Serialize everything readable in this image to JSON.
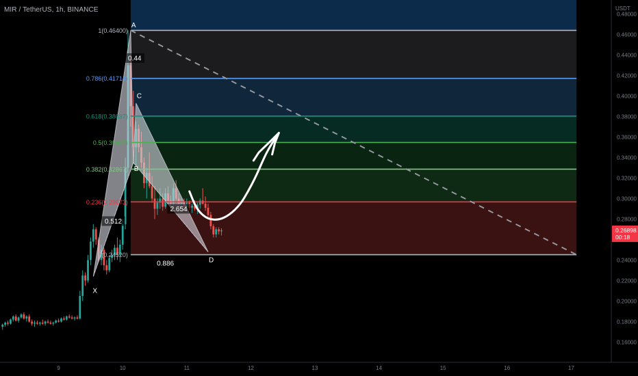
{
  "header": {
    "symbol_line": "MIR / TetherUS, 1h, BINANCE"
  },
  "price_axis": {
    "unit": "USDT"
  },
  "colors": {
    "background": "#000000",
    "candle_up": "#26a69a",
    "candle_down": "#ef5350",
    "level_1": "#b2b5be",
    "level_0786": "#5b9cf6",
    "level_0618": "#089981",
    "level_05": "#4caf50",
    "level_0382": "#81c784",
    "level_0236": "#f23645",
    "level_0": "#b2b5be",
    "pattern_fill": "#d1d4dc",
    "last_price_tag": "#f23645"
  },
  "chart_data": {
    "type": "candlestick",
    "y_axis": {
      "min": 0.14,
      "max": 0.49,
      "ticks": [
        "0.48000",
        "0.46000",
        "0.44000",
        "0.42000",
        "0.40000",
        "0.38000",
        "0.36000",
        "0.34000",
        "0.32000",
        "0.30000",
        "0.28000",
        "0.26000",
        "0.24000",
        "0.22000",
        "0.20000",
        "0.18000",
        "0.16000"
      ]
    },
    "x_axis": {
      "ticks": [
        "9",
        "10",
        "11",
        "12",
        "13",
        "14",
        "15",
        "16",
        "17"
      ],
      "tick_hours": [
        0,
        24,
        48,
        72,
        96,
        120,
        144,
        168,
        192
      ]
    },
    "candles": [
      [
        -21,
        0.175,
        0.178,
        0.172,
        0.177
      ],
      [
        -20,
        0.177,
        0.18,
        0.175,
        0.179
      ],
      [
        -19,
        0.179,
        0.181,
        0.176,
        0.178
      ],
      [
        -18,
        0.178,
        0.183,
        0.177,
        0.182
      ],
      [
        -17,
        0.182,
        0.186,
        0.18,
        0.185
      ],
      [
        -16,
        0.185,
        0.187,
        0.18,
        0.181
      ],
      [
        -15,
        0.181,
        0.185,
        0.179,
        0.184
      ],
      [
        -14,
        0.184,
        0.188,
        0.183,
        0.187
      ],
      [
        -13,
        0.187,
        0.189,
        0.182,
        0.183
      ],
      [
        -12,
        0.183,
        0.186,
        0.18,
        0.185
      ],
      [
        -11,
        0.185,
        0.187,
        0.179,
        0.18
      ],
      [
        -10,
        0.18,
        0.182,
        0.176,
        0.178
      ],
      [
        -9,
        0.178,
        0.181,
        0.175,
        0.179
      ],
      [
        -8,
        0.179,
        0.181,
        0.177,
        0.178
      ],
      [
        -7,
        0.178,
        0.18,
        0.176,
        0.179
      ],
      [
        -6,
        0.179,
        0.182,
        0.177,
        0.178
      ],
      [
        -5,
        0.178,
        0.181,
        0.176,
        0.18
      ],
      [
        -4,
        0.18,
        0.182,
        0.178,
        0.179
      ],
      [
        -3,
        0.179,
        0.181,
        0.177,
        0.178
      ],
      [
        -2,
        0.178,
        0.18,
        0.176,
        0.179
      ],
      [
        -1,
        0.179,
        0.182,
        0.178,
        0.181
      ],
      [
        0,
        0.181,
        0.183,
        0.179,
        0.18
      ],
      [
        1,
        0.18,
        0.184,
        0.179,
        0.183
      ],
      [
        2,
        0.183,
        0.185,
        0.181,
        0.182
      ],
      [
        3,
        0.182,
        0.186,
        0.181,
        0.185
      ],
      [
        4,
        0.185,
        0.187,
        0.183,
        0.184
      ],
      [
        5,
        0.184,
        0.186,
        0.182,
        0.183
      ],
      [
        6,
        0.183,
        0.185,
        0.181,
        0.184
      ],
      [
        7,
        0.184,
        0.186,
        0.182,
        0.183
      ],
      [
        8,
        0.183,
        0.21,
        0.182,
        0.205
      ],
      [
        9,
        0.205,
        0.23,
        0.2,
        0.225
      ],
      [
        10,
        0.225,
        0.228,
        0.215,
        0.22
      ],
      [
        11,
        0.22,
        0.245,
        0.218,
        0.24
      ],
      [
        12,
        0.24,
        0.262,
        0.235,
        0.258
      ],
      [
        13,
        0.258,
        0.275,
        0.252,
        0.27
      ],
      [
        14,
        0.27,
        0.272,
        0.255,
        0.26
      ],
      [
        15,
        0.26,
        0.262,
        0.238,
        0.24
      ],
      [
        16,
        0.24,
        0.255,
        0.235,
        0.25
      ],
      [
        17,
        0.25,
        0.252,
        0.23,
        0.235
      ],
      [
        18,
        0.235,
        0.24,
        0.226,
        0.23
      ],
      [
        19,
        0.23,
        0.245,
        0.228,
        0.242
      ],
      [
        20,
        0.242,
        0.25,
        0.238,
        0.245
      ],
      [
        21,
        0.245,
        0.255,
        0.24,
        0.252
      ],
      [
        22,
        0.252,
        0.262,
        0.24,
        0.245
      ],
      [
        23,
        0.245,
        0.26,
        0.238,
        0.255
      ],
      [
        24,
        0.255,
        0.28,
        0.25,
        0.275
      ],
      [
        25,
        0.275,
        0.34,
        0.27,
        0.33
      ],
      [
        26,
        0.33,
        0.464,
        0.32,
        0.43
      ],
      [
        27,
        0.43,
        0.44,
        0.37,
        0.39
      ],
      [
        28,
        0.39,
        0.405,
        0.34,
        0.35
      ],
      [
        29,
        0.35,
        0.375,
        0.332,
        0.368
      ],
      [
        30,
        0.368,
        0.372,
        0.345,
        0.35
      ],
      [
        31,
        0.35,
        0.365,
        0.33,
        0.335
      ],
      [
        32,
        0.335,
        0.34,
        0.31,
        0.315
      ],
      [
        33,
        0.315,
        0.33,
        0.3,
        0.325
      ],
      [
        34,
        0.325,
        0.345,
        0.31,
        0.312
      ],
      [
        35,
        0.312,
        0.322,
        0.296,
        0.3
      ],
      [
        36,
        0.3,
        0.312,
        0.28,
        0.29
      ],
      [
        37,
        0.29,
        0.3,
        0.284,
        0.296
      ],
      [
        38,
        0.296,
        0.31,
        0.29,
        0.3
      ],
      [
        39,
        0.3,
        0.305,
        0.288,
        0.292
      ],
      [
        40,
        0.292,
        0.31,
        0.29,
        0.305
      ],
      [
        41,
        0.305,
        0.312,
        0.295,
        0.298
      ],
      [
        42,
        0.298,
        0.303,
        0.288,
        0.295
      ],
      [
        43,
        0.295,
        0.315,
        0.29,
        0.31
      ],
      [
        44,
        0.31,
        0.318,
        0.298,
        0.3
      ],
      [
        45,
        0.3,
        0.305,
        0.29,
        0.295
      ],
      [
        46,
        0.295,
        0.3,
        0.288,
        0.297
      ],
      [
        47,
        0.297,
        0.3,
        0.29,
        0.292
      ],
      [
        48,
        0.292,
        0.3,
        0.288,
        0.296
      ],
      [
        49,
        0.296,
        0.298,
        0.289,
        0.291
      ],
      [
        50,
        0.291,
        0.295,
        0.286,
        0.293
      ],
      [
        51,
        0.293,
        0.298,
        0.288,
        0.29
      ],
      [
        52,
        0.29,
        0.296,
        0.285,
        0.294
      ],
      [
        53,
        0.294,
        0.3,
        0.29,
        0.298
      ],
      [
        54,
        0.298,
        0.31,
        0.294,
        0.295
      ],
      [
        55,
        0.295,
        0.302,
        0.288,
        0.291
      ],
      [
        56,
        0.291,
        0.295,
        0.282,
        0.284
      ],
      [
        57,
        0.284,
        0.287,
        0.27,
        0.273
      ],
      [
        58,
        0.273,
        0.275,
        0.262,
        0.265
      ],
      [
        59,
        0.265,
        0.272,
        0.262,
        0.27
      ],
      [
        60,
        0.27,
        0.272,
        0.265,
        0.268
      ],
      [
        61,
        0.268,
        0.271,
        0.264,
        0.269
      ]
    ],
    "fib_levels": [
      {
        "ratio": "1",
        "price": 0.464,
        "label": "1(0.46400)",
        "color": "#b2b5be"
      },
      {
        "ratio": "0.786",
        "price": 0.41714,
        "label": "0.786(0.41714)",
        "color": "#5b9cf6"
      },
      {
        "ratio": "0.618",
        "price": 0.38037,
        "label": "0.618(0.38037)",
        "color": "#089981"
      },
      {
        "ratio": "0.5",
        "price": 0.35462,
        "label": "0.5(0.35462)",
        "color": "#4caf50"
      },
      {
        "ratio": "0.382",
        "price": 0.32867,
        "label": "0.382(0.32867)",
        "color": "#81c784"
      },
      {
        "ratio": "0.236",
        "price": 0.29673,
        "label": "0.236(0.29673)",
        "color": "#f23645"
      },
      {
        "ratio": "0",
        "price": 0.2452,
        "label": "0(0.24520)",
        "color": "#b2b5be"
      }
    ],
    "fib_zone_fills": [
      "#0c2a49",
      "#1c1c1f",
      "#10263a",
      "#062b23",
      "#0a2412",
      "#0f2a14",
      "#3a1212"
    ],
    "fib_hours": [
      27,
      194
    ],
    "pattern_points": [
      {
        "name": "X",
        "hour": 13,
        "price": 0.224
      },
      {
        "name": "A",
        "hour": 27,
        "price": 0.464
      },
      {
        "name": "B",
        "hour": 28,
        "price": 0.335
      },
      {
        "name": "C",
        "hour": 29,
        "price": 0.393
      },
      {
        "name": "D",
        "hour": 56,
        "price": 0.248
      }
    ],
    "point_labels": [
      {
        "text": "A",
        "hour": 27,
        "price": 0.469
      },
      {
        "text": "C",
        "hour": 29,
        "price": 0.4
      },
      {
        "text": "B",
        "hour": 28,
        "price": 0.329
      },
      {
        "text": "X",
        "hour": 12.5,
        "price": 0.21
      },
      {
        "text": "D",
        "hour": 56,
        "price": 0.24
      }
    ],
    "ratio_labels": [
      {
        "text": "0.44",
        "hour": 28.5,
        "price": 0.437
      },
      {
        "text": "0.512",
        "hour": 20.5,
        "price": 0.278
      },
      {
        "text": "2.654",
        "hour": 45,
        "price": 0.29
      },
      {
        "text": "0.886",
        "hour": 40,
        "price": 0.237
      }
    ],
    "projection_line": [
      [
        27,
        0.464
      ],
      [
        194,
        0.2452
      ]
    ],
    "hand_arrow": [
      [
        49,
        0.307
      ],
      [
        51,
        0.294
      ],
      [
        53,
        0.286
      ],
      [
        56,
        0.28
      ],
      [
        60,
        0.279
      ],
      [
        64,
        0.284
      ],
      [
        68,
        0.294
      ],
      [
        71,
        0.307
      ],
      [
        74,
        0.322
      ],
      [
        77,
        0.34
      ],
      [
        79,
        0.35
      ],
      [
        81,
        0.358
      ],
      [
        82.5,
        0.364
      ]
    ],
    "hand_arrow_head": [
      [
        73,
        0.337
      ],
      [
        75,
        0.345
      ],
      [
        79,
        0.355
      ],
      [
        82.5,
        0.364
      ],
      [
        81,
        0.354
      ],
      [
        80,
        0.343
      ]
    ],
    "last_price": {
      "price": 0.26898,
      "label": "0.26898",
      "countdown": "00:18"
    }
  }
}
